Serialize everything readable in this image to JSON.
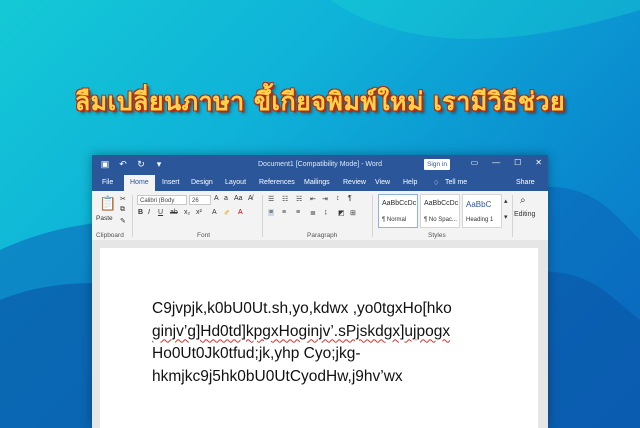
{
  "headline": "ลืมเปลี่ยนภาษา ขึ้เกียจพิมพ์ใหม่ เรามีวิธีช่วย",
  "word": {
    "title": "Document1 [Compatibility Mode] - Word",
    "signin": "Sign in",
    "tabs": [
      "File",
      "Home",
      "Insert",
      "Design",
      "Layout",
      "References",
      "Mailings",
      "Review",
      "View",
      "Help",
      "Tell me",
      "Share"
    ],
    "active_tab": "Home",
    "ribbon": {
      "paste": "Paste",
      "clipboard": "Clipboard",
      "font_name": "Calibri (Body",
      "font_size": "26",
      "font": "Font",
      "paragraph": "Paragraph",
      "styles": "Styles",
      "editing": "Editing",
      "style_cards": [
        {
          "preview": "AaBbCcDc",
          "name": "¶ Normal"
        },
        {
          "preview": "AaBbCcDc",
          "name": "¶ No Spac..."
        },
        {
          "preview": "AaBbC",
          "name": "Heading 1"
        }
      ]
    },
    "document_lines": [
      "C9jvpjk,k0bU0Ut.sh,yo,kdwx ,yo0tgxHo[hko",
      "ginjv’g]Hd0td]kpgxHoginjv’.sPjskdgx]ujpogx",
      "Ho0Ut0Jk0tfud;jk,yhp Cyo;jkg-",
      "hkmjkc9j5hk0bU0UtCyodHw,j9hv’wx"
    ]
  },
  "colors": {
    "word_blue": "#2b579a",
    "headline_fill": "#ffd24a",
    "headline_outline": "#b52a13"
  }
}
